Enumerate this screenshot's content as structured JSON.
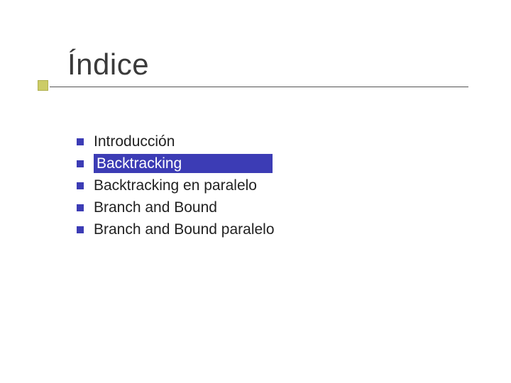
{
  "title": "Índice",
  "items": [
    {
      "label": "Introducción",
      "highlighted": false
    },
    {
      "label": "Backtracking",
      "highlighted": true
    },
    {
      "label": "Backtracking en paralelo",
      "highlighted": false
    },
    {
      "label": "Branch and Bound",
      "highlighted": false
    },
    {
      "label": "Branch and Bound paralelo",
      "highlighted": false
    }
  ],
  "colors": {
    "accent_square": "#cccc66",
    "bullet": "#3c3cb5",
    "highlight_bg": "#3c3cb5"
  }
}
